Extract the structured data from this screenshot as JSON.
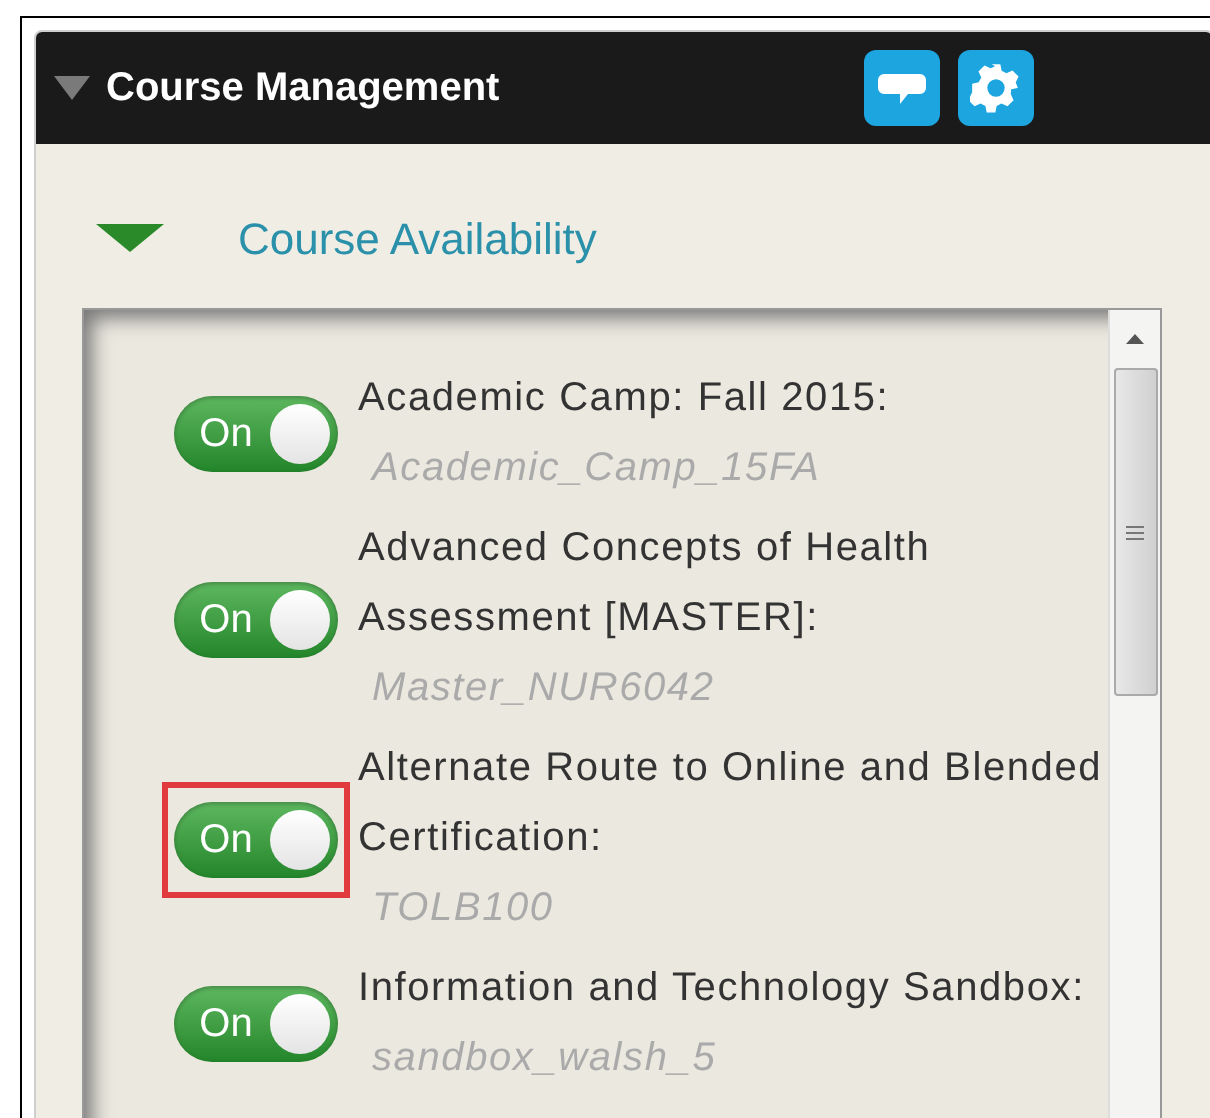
{
  "panel": {
    "title": "Course Management",
    "expanded": true
  },
  "section": {
    "title": "Course Availability",
    "expanded": true
  },
  "courses": [
    {
      "title": "Academic Camp: Fall 2015:",
      "code": "Academic_Camp_15FA",
      "toggle_label": "On",
      "on": true,
      "highlighted": false
    },
    {
      "title": "Advanced Concepts of Health Assessment [MASTER]:",
      "code": "Master_NUR6042",
      "toggle_label": "On",
      "on": true,
      "highlighted": false
    },
    {
      "title": "Alternate Route to Online and Blended Certification:",
      "code": "TOLB100",
      "toggle_label": "On",
      "on": true,
      "highlighted": true
    },
    {
      "title": "Information and Technology Sandbox:",
      "code": "sandbox_walsh_5",
      "toggle_label": "On",
      "on": true,
      "highlighted": false
    }
  ]
}
